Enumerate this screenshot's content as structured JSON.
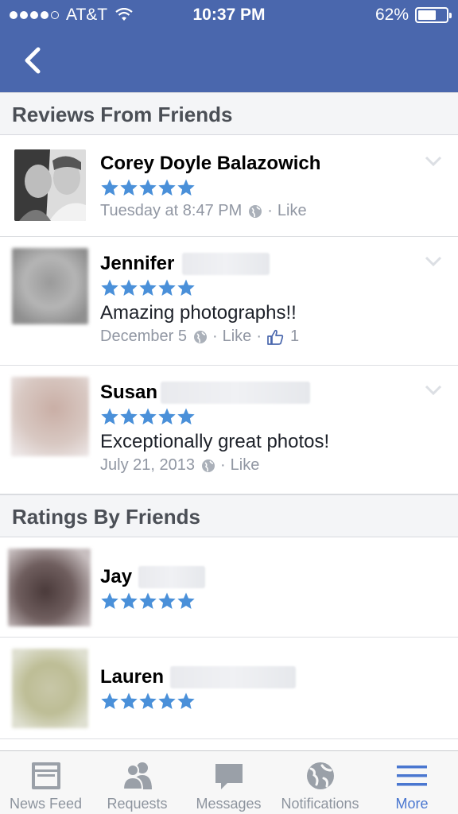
{
  "status_bar": {
    "carrier": "AT&T",
    "time": "10:37 PM",
    "battery": "62%"
  },
  "sections": {
    "reviews_title": "Reviews From Friends",
    "ratings_title": "Ratings By Friends"
  },
  "reviews": [
    {
      "name": "Corey Doyle Balazowich",
      "stars": 5,
      "text": "",
      "date": "Tuesday at 8:47 PM",
      "like": "Like"
    },
    {
      "name": "Jennifer",
      "stars": 5,
      "text": "Amazing photographs!!",
      "date": "December 5",
      "like": "Like",
      "like_count": "1"
    },
    {
      "name": "Susan",
      "stars": 5,
      "text": "Exceptionally great photos!",
      "date": "July 21, 2013",
      "like": "Like"
    }
  ],
  "ratings": [
    {
      "name": "Jay",
      "stars": 5
    },
    {
      "name": "Lauren",
      "stars": 5
    }
  ],
  "tabs": [
    {
      "label": "News Feed",
      "icon": "news-feed-icon"
    },
    {
      "label": "Requests",
      "icon": "requests-icon"
    },
    {
      "label": "Messages",
      "icon": "messages-icon"
    },
    {
      "label": "Notifications",
      "icon": "globe-icon"
    },
    {
      "label": "More",
      "icon": "menu-icon"
    }
  ],
  "colors": {
    "header": "#4a67ad",
    "star": "#4a90d9",
    "active_tab": "#4a77d0",
    "inactive_tab": "#8d949e"
  },
  "separator": "·"
}
